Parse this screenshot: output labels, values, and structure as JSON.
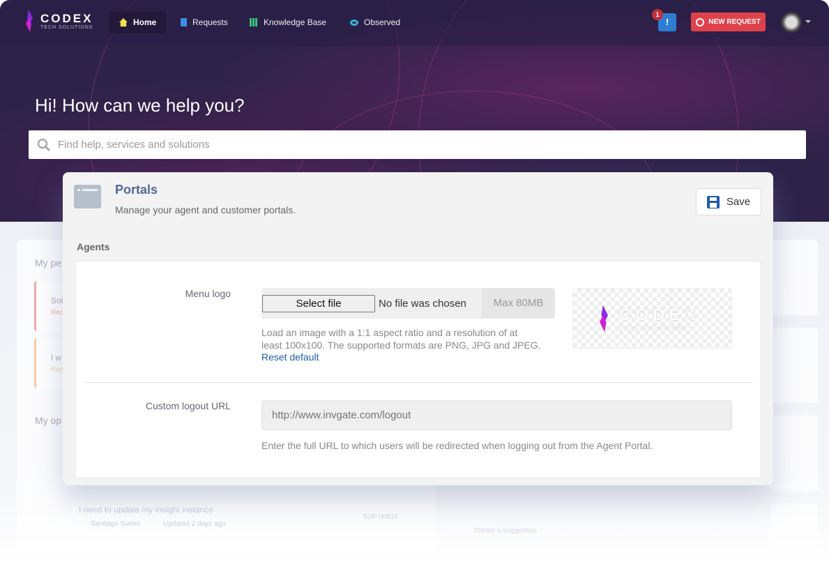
{
  "nav": {
    "brand": "CODEX",
    "brand_sub": "TECH SOLUTIONS",
    "items": [
      {
        "label": "Home",
        "icon": "home-icon",
        "color": "#f2e04b",
        "active": true
      },
      {
        "label": "Requests",
        "icon": "request-icon",
        "color": "#3b8ee8"
      },
      {
        "label": "Knowledge Base",
        "icon": "books-icon",
        "color": "#3cc47c"
      },
      {
        "label": "Observed",
        "icon": "eye-icon",
        "color": "#34b7d4"
      }
    ],
    "alert_count": "1",
    "new_request": "NEW REQUEST"
  },
  "hero": {
    "greeting": "Hi! How can we help you?",
    "search_placeholder": "Find help, services and solutions"
  },
  "background": {
    "my_pending": "My pe",
    "item1": "Sol",
    "item1_sub": "Rec",
    "item2": "I w",
    "item2_sub": "Rec",
    "my_open": "My op",
    "request_title": "I need to update my Insight instance",
    "request_user": "Santiago Sueiro",
    "request_updated": "Updated 2 days ago",
    "request_id": "SUP 00816",
    "suggestion": "Create a suggestion"
  },
  "modal": {
    "title": "Portals",
    "subtitle": "Manage your agent and customer portals.",
    "save": "Save",
    "section": "Agents",
    "menu_logo": {
      "label": "Menu logo",
      "select_button": "Select file",
      "no_file": "No file was chosen",
      "max": "Max 80MB",
      "help_line1": "Load an image with a 1:1 aspect ratio and a resolution of at",
      "help_line2": "least 100x100. The supported formats are PNG, JPG and JPEG.",
      "reset": "Reset default",
      "preview_brand": "CODEX",
      "preview_sub": "TECH SOLUTIONS"
    },
    "logout": {
      "label": "Custom logout URL",
      "placeholder": "http://www.invgate.com/logout",
      "help": "Enter the full URL to which users will be redirected when logging out from the Agent Portal."
    }
  },
  "colors": {
    "header": "#2d2349",
    "accent_red": "#e0424c",
    "title_blue": "#4f6a94",
    "link": "#1f5fa8"
  }
}
